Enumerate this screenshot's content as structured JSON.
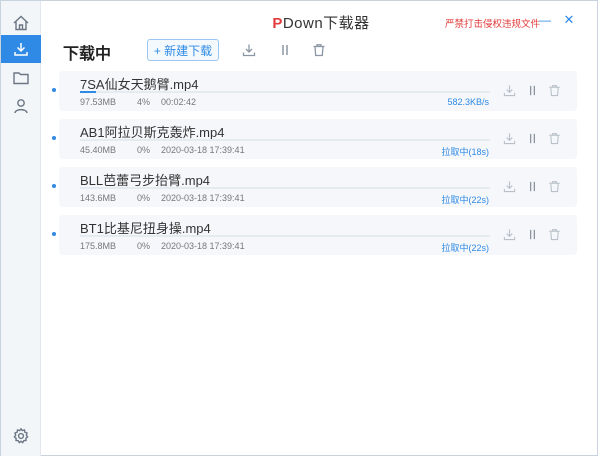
{
  "app": {
    "title_p": "P",
    "title_rest": "Down下载器",
    "warning_link": "严禁打击侵权违规文件",
    "minimize": "—",
    "close": "✕"
  },
  "sidebar": {
    "items": [
      {
        "icon": "home-icon"
      },
      {
        "icon": "download-icon",
        "active": true
      },
      {
        "icon": "folder-icon"
      },
      {
        "icon": "user-icon"
      },
      {
        "icon": "settings-icon"
      }
    ]
  },
  "toolbar": {
    "title": "下载中",
    "new_download": "+ 新建下载"
  },
  "downloads": [
    {
      "name": "7SA仙女天鹅臂.mp4",
      "size": "97.53MB",
      "percent": "4%",
      "info": "00:02:42",
      "status": "582.3KB/s",
      "progress": 0.04
    },
    {
      "name": "AB1阿拉贝斯克轰炸.mp4",
      "size": "45.40MB",
      "percent": "0%",
      "info": "2020-03-18 17:39:41",
      "status": "拉取中(18s)",
      "progress": 0
    },
    {
      "name": "BLL芭蕾弓步抬臂.mp4",
      "size": "143.6MB",
      "percent": "0%",
      "info": "2020-03-18 17:39:41",
      "status": "拉取中(22s)",
      "progress": 0
    },
    {
      "name": "BT1比基尼扭身操.mp4",
      "size": "175.8MB",
      "percent": "0%",
      "info": "2020-03-18 17:39:41",
      "status": "拉取中(22s)",
      "progress": 0
    }
  ],
  "colors": {
    "accent": "#2f8ae5",
    "brand_red": "#e23b3b"
  }
}
